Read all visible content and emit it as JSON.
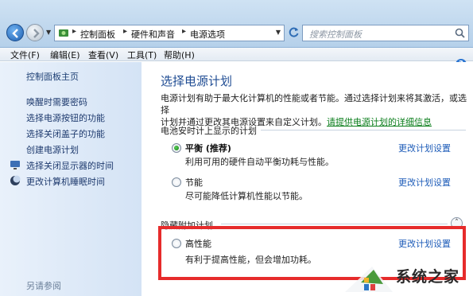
{
  "address_bar": {
    "crumbs": [
      "控制面板",
      "硬件和声音",
      "电源选项"
    ],
    "search_placeholder": "搜索控制面板"
  },
  "menu": [
    "文件(F)",
    "编辑(E)",
    "查看(V)",
    "工具(T)",
    "帮助(H)"
  ],
  "sidebar": {
    "title": "控制面板主页",
    "links": [
      "唤醒时需要密码",
      "选择电源按钮的功能",
      "选择关闭盖子的功能",
      "创建电源计划",
      "选择关闭显示器的时间",
      "更改计算机睡眠时间"
    ],
    "see_also": "另请参阅"
  },
  "main": {
    "title": "选择电源计划",
    "intro_line1": "电源计划有助于最大化计算机的性能或者节能。通过选择计划来将其激活，或选择",
    "intro_line2_prefix": "计划并通过更改其电源设置来自定义计划。",
    "intro_link": "请提供电源计划的详细信息",
    "battery_group": "电池安时计上显示的计划",
    "hidden_group": "隐藏附加计划",
    "plans": [
      {
        "name": "平衡 (推荐)",
        "desc": "利用可用的硬件自动平衡功耗与性能。",
        "link": "更改计划设置",
        "selected": true
      },
      {
        "name": "节能",
        "desc": "尽可能降低计算机性能以节能。",
        "link": "更改计划设置",
        "selected": false
      },
      {
        "name": "高性能",
        "desc": "有利于提高性能，但会增加功耗。",
        "link": "更改计划设置",
        "selected": false
      }
    ]
  },
  "watermark": "系统之家",
  "colors": {
    "accent": "#1f4c93",
    "link": "#1c5bb8",
    "highlight": "#e62b2b"
  }
}
